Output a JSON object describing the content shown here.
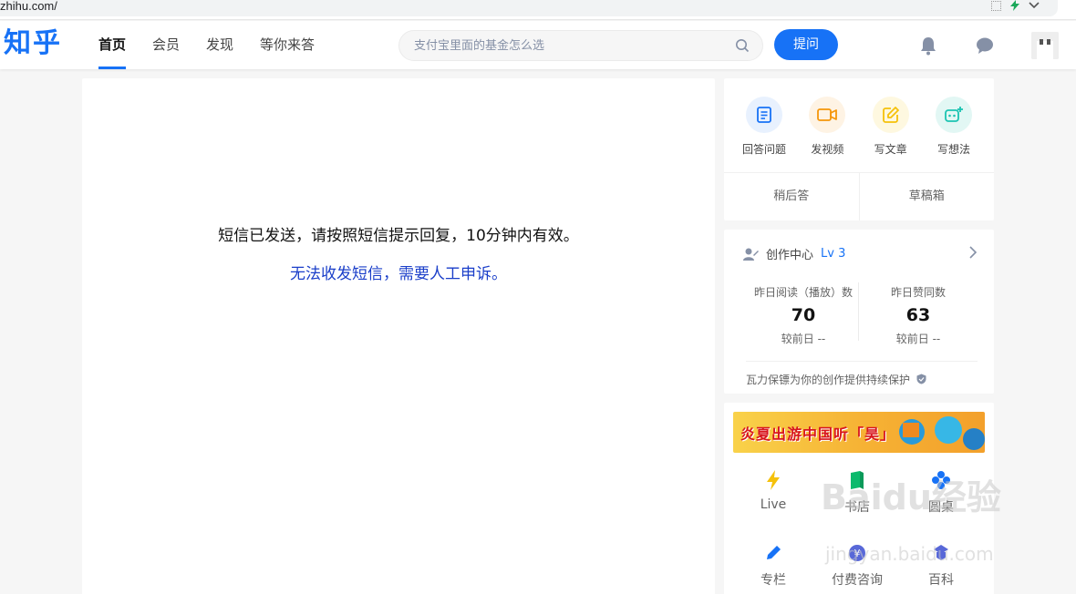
{
  "browser": {
    "url": "zhihu.com/"
  },
  "header": {
    "logo": "知乎",
    "nav": [
      "首页",
      "会员",
      "发现",
      "等你来答"
    ],
    "search_placeholder": "支付宝里面的基金怎么选",
    "ask_button": "提问"
  },
  "main": {
    "message": "短信已发送，请按照短信提示回复，10分钟内有效。",
    "appeal_link": "无法收发短信，需要人工申诉。"
  },
  "create": {
    "items": [
      {
        "label": "回答问题",
        "icon": "answer-icon",
        "color": "#1772f6"
      },
      {
        "label": "发视频",
        "icon": "video-icon",
        "color": "#f5960a"
      },
      {
        "label": "写文章",
        "icon": "article-icon",
        "color": "#f5c10a"
      },
      {
        "label": "写想法",
        "icon": "idea-icon",
        "color": "#1bc4b2"
      }
    ],
    "later_answer": "稍后答",
    "drafts": "草稿箱"
  },
  "creation_center": {
    "title": "创作中心",
    "level": "Lv 3",
    "stats": [
      {
        "title": "昨日阅读（播放）数",
        "value": "70",
        "delta": "较前日 --"
      },
      {
        "title": "昨日赞同数",
        "value": "63",
        "delta": "较前日 --"
      }
    ],
    "footer": "瓦力保镖为你的创作提供持续保护"
  },
  "tools": {
    "banner_text": "炎夏出游中国听「昊」",
    "items": [
      {
        "label": "Live",
        "icon": "lightning-icon",
        "color": "#f5c10a"
      },
      {
        "label": "书店",
        "icon": "book-icon",
        "color": "#0cba6d"
      },
      {
        "label": "圆桌",
        "icon": "roundtable-icon",
        "color": "#1772f6"
      },
      {
        "label": "专栏",
        "icon": "pen-icon",
        "color": "#1772f6"
      },
      {
        "label": "付费咨询",
        "icon": "consult-icon",
        "color": "#5868d8"
      },
      {
        "label": "百科",
        "icon": "wiki-icon",
        "color": "#5868d8"
      }
    ]
  },
  "watermark": {
    "text1": "Baidu经验",
    "text2": "jingyan.baidu.com"
  }
}
